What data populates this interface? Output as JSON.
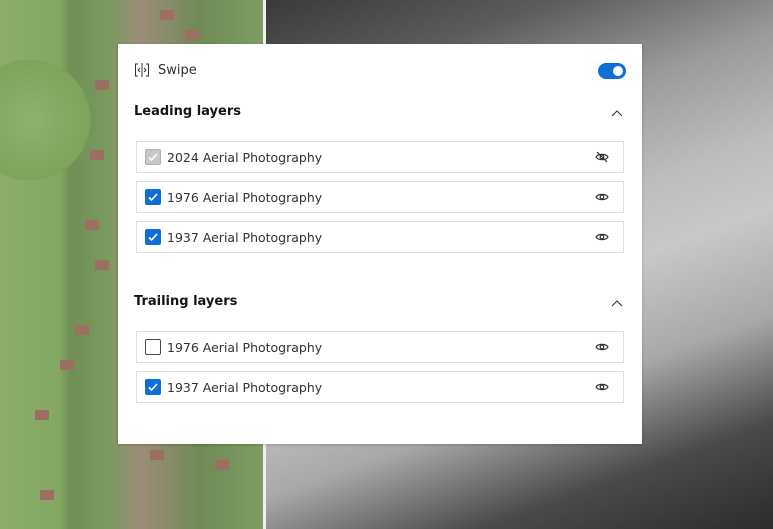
{
  "swipe": {
    "label": "Swipe",
    "enabled": true,
    "accent": "#0f6ed7"
  },
  "leading": {
    "title": "Leading layers",
    "expanded": true,
    "layers": [
      {
        "label": "2024 Aerial Photography",
        "checked": true,
        "disabled": true,
        "visible": false
      },
      {
        "label": "1976 Aerial Photography",
        "checked": true,
        "disabled": false,
        "visible": true
      },
      {
        "label": "1937 Aerial Photography",
        "checked": true,
        "disabled": false,
        "visible": true
      }
    ]
  },
  "trailing": {
    "title": "Trailing layers",
    "expanded": true,
    "layers": [
      {
        "label": "1976 Aerial Photography",
        "checked": false,
        "disabled": false,
        "visible": true
      },
      {
        "label": "1937 Aerial Photography",
        "checked": true,
        "disabled": false,
        "visible": true
      }
    ]
  }
}
